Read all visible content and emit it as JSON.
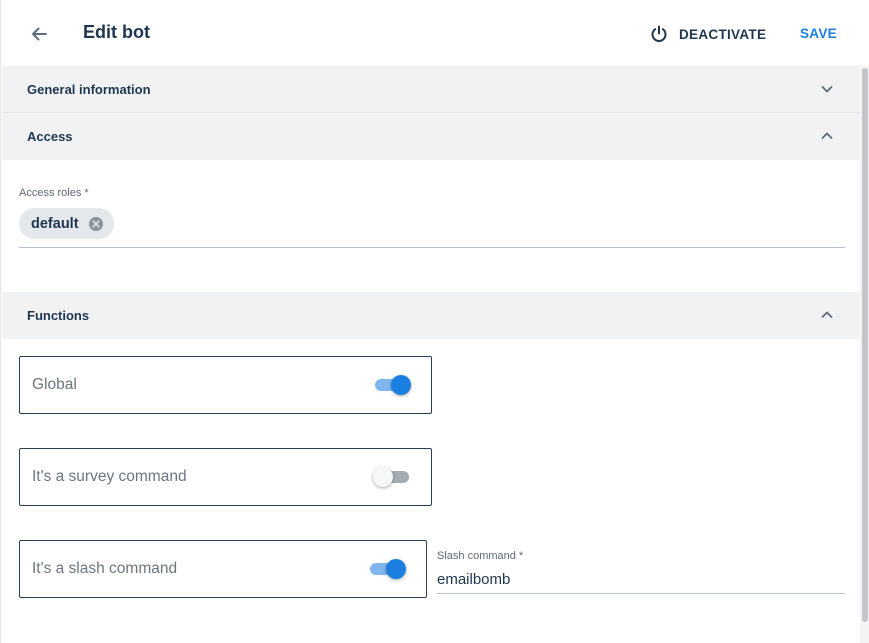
{
  "header": {
    "title": "Edit bot",
    "deactivate_label": "DEACTIVATE",
    "save_label": "SAVE"
  },
  "sections": {
    "general": {
      "title": "General information",
      "expanded": false
    },
    "access": {
      "title": "Access",
      "expanded": true
    },
    "functions": {
      "title": "Functions",
      "expanded": true
    }
  },
  "access": {
    "roles_label": "Access roles *",
    "roles": [
      "default"
    ]
  },
  "functions": {
    "global": {
      "label": "Global",
      "enabled": true
    },
    "survey": {
      "label": "It's a survey command",
      "enabled": false
    },
    "slash": {
      "label": "It's a slash command",
      "enabled": true
    },
    "slash_command": {
      "label": "Slash command *",
      "value": "emailbomb"
    }
  },
  "colors": {
    "accent": "#1a7fe0",
    "text": "#1f3650",
    "section_bg": "#f1f2f4"
  },
  "icons": {
    "back": "arrow-left-icon",
    "deactivate": "power-icon",
    "collapsed": "chevron-down-icon",
    "expanded": "chevron-up-icon",
    "chip_remove": "cancel-circle-icon"
  }
}
